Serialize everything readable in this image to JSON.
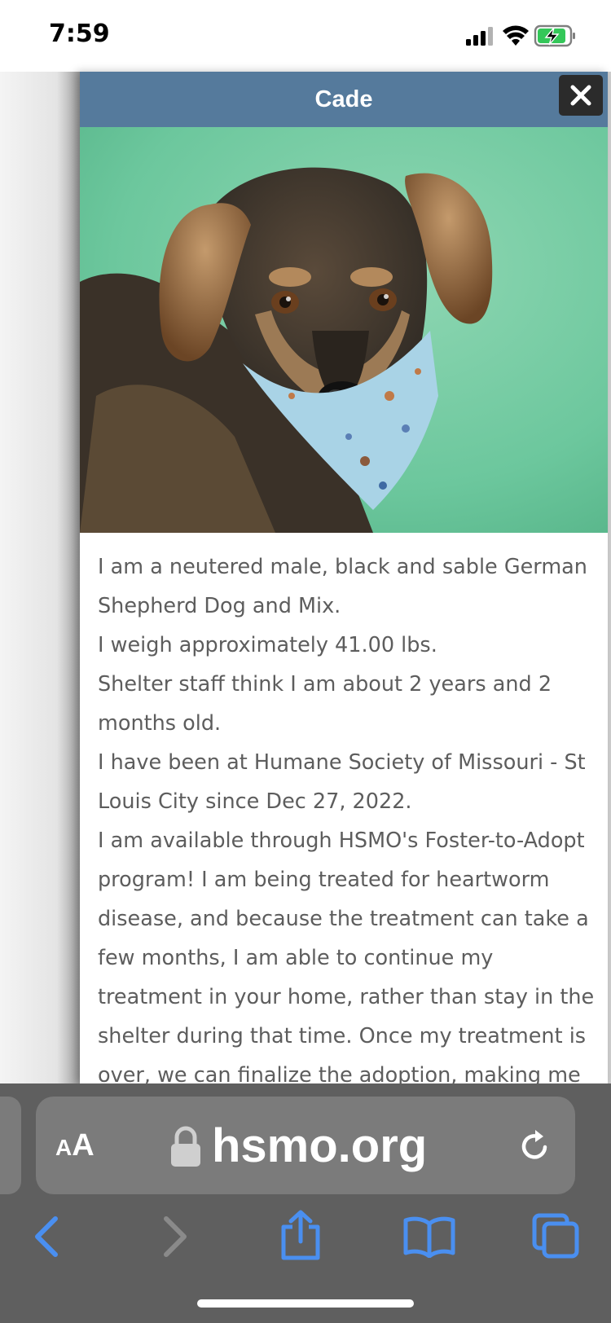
{
  "status_bar": {
    "time": "7:59",
    "icons": [
      "signal-icon",
      "wifi-icon",
      "battery-charging-icon"
    ]
  },
  "modal": {
    "title": "Cade",
    "close_icon": "close-icon",
    "photo_alt": "Cade"
  },
  "description": {
    "paragraphs": [
      "I am a neutered male, black and sable German Shepherd Dog and Mix.",
      "I weigh approximately 41.00 lbs.",
      "Shelter staff think I am about 2 years and 2 months old.",
      "I have been at Humane Society of Missouri - St Louis City since Dec 27, 2022.",
      "I am available through HSMO's Foster-to-Adopt program! I am being treated for heartworm disease, and because the treatment can take a few months, I am able to continue my treatment in your home, rather than stay in the shelter during that time. Once my treatment is over, we can finalize the adoption, making me a"
    ]
  },
  "browser": {
    "text_size_small": "A",
    "text_size_large": "A",
    "url": "hsmo.org",
    "icons": {
      "lock": "lock-icon",
      "reload": "reload-icon",
      "back": "back-icon",
      "forward": "forward-icon",
      "share": "share-icon",
      "bookmarks": "bookmarks-icon",
      "tabs": "tabs-icon"
    }
  },
  "colors": {
    "modal_header": "#557a9c",
    "text": "#5d5d5d",
    "safari_bar": "#5f5f5f",
    "toolbar_active": "#4a8ff0",
    "toolbar_disabled": "#8a8a8a"
  }
}
